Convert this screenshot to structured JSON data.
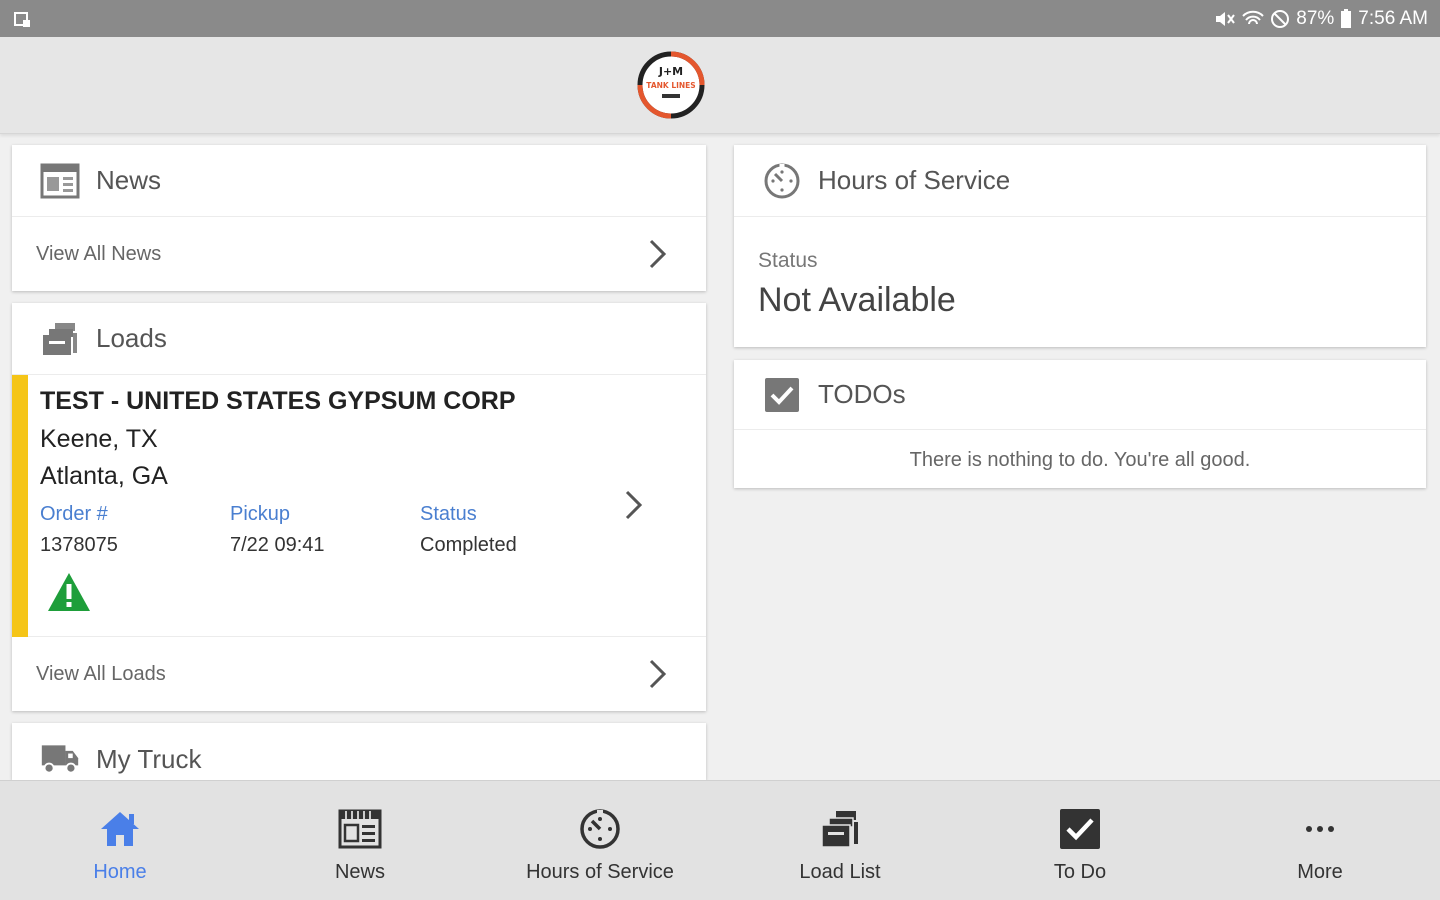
{
  "status_bar": {
    "battery": "87%",
    "time": "7:56 AM"
  },
  "logo": {
    "text_top": "J+M",
    "text_bottom": "TANK LINES",
    "accent": "#e4572e"
  },
  "news_card": {
    "title": "News",
    "link": "View All News"
  },
  "loads_card": {
    "title": "Loads",
    "load": {
      "name": "TEST -  UNITED STATES GYPSUM CORP",
      "origin": "Keene, TX",
      "destination": "Atlanta, GA",
      "order_label": "Order #",
      "order_value": "1378075",
      "pickup_label": "Pickup",
      "pickup_value": "7/22 09:41",
      "status_label": "Status",
      "status_value": "Completed",
      "warning_icon": "warning-triangle-icon"
    },
    "link": "View All Loads"
  },
  "truck_card": {
    "title": "My Truck"
  },
  "hos_card": {
    "title": "Hours of Service",
    "status_label": "Status",
    "status_value": "Not Available"
  },
  "todo_card": {
    "title": "TODOs",
    "message": "There is nothing to do. You're all good."
  },
  "bottom_nav": [
    {
      "label": "Home",
      "icon": "home-icon",
      "active": true
    },
    {
      "label": "News",
      "icon": "news-icon",
      "active": false
    },
    {
      "label": "Hours of Service",
      "icon": "clock-icon",
      "active": false
    },
    {
      "label": "Load List",
      "icon": "load-list-icon",
      "active": false
    },
    {
      "label": "To Do",
      "icon": "checkbox-icon",
      "active": false
    },
    {
      "label": "More",
      "icon": "more-icon",
      "active": false
    }
  ],
  "colors": {
    "active": "#4a7fe8",
    "load_bar": "#f5c518",
    "warning": "#1e9e3a",
    "link_blue": "#4a7fd0"
  }
}
